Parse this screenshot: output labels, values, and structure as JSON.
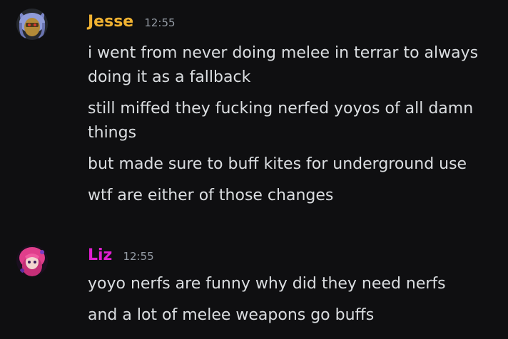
{
  "messages": [
    {
      "username": "Jesse",
      "username_color": "#f0b232",
      "timestamp": "12:55",
      "avatar_icon": "anime-cat-ear-avatar-icon",
      "lines": [
        "i went from never doing melee in terrar to always doing it as a fallback",
        "still miffed they fucking nerfed yoyos of all damn things",
        "but made sure to buff kites for underground use",
        "wtf are either of those changes"
      ]
    },
    {
      "username": "Liz",
      "username_color": "#e01fd1",
      "timestamp": "12:55",
      "avatar_icon": "pink-haired-anime-avatar-icon",
      "lines": [
        "yoyo nerfs are funny why did they need nerfs",
        "and a lot of melee weapons go buffs"
      ]
    }
  ],
  "colors": {
    "background": "#0f0f11",
    "text": "#dbdee1",
    "timestamp": "#949ba4"
  }
}
